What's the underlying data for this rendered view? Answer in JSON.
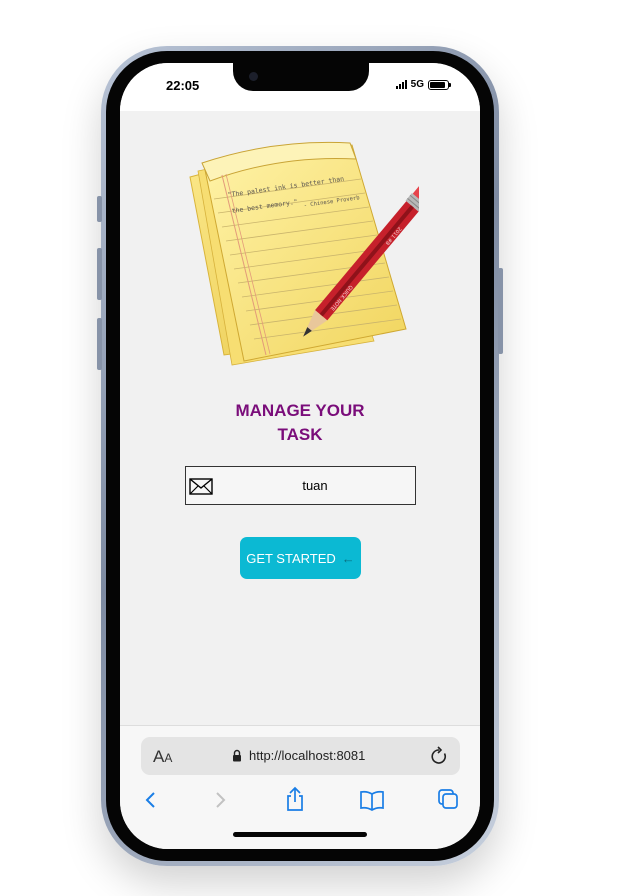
{
  "status_bar": {
    "time": "22:05",
    "network": "5G",
    "battery_level": 0.9
  },
  "app": {
    "title_line1": "MANAGE YOUR",
    "title_line2": "TASK",
    "logo": {
      "quote_line1": "\"The palest ink is better than",
      "quote_line2": "the best memory.\"",
      "quote_source": "- Chinese Proverb",
      "pencil_text": "QUICK NOTE",
      "pencil_num": "2011 #8"
    },
    "email_field": {
      "value": "tuan",
      "icon": "envelope-icon"
    },
    "cta": {
      "label": "GET STARTED",
      "icon": "arrow-left-icon"
    }
  },
  "browser": {
    "text_size_label": "A",
    "text_size_label_small": "A",
    "url": "http://localhost:8081",
    "toolbar": [
      "back-icon",
      "forward-icon",
      "share-icon",
      "bookmarks-icon",
      "tabs-icon"
    ],
    "accent": "#1a7ee6"
  },
  "colors": {
    "title": "#7a0d7a",
    "cta": "#0bb9d3",
    "screen_bg": "#f1f1f1"
  }
}
